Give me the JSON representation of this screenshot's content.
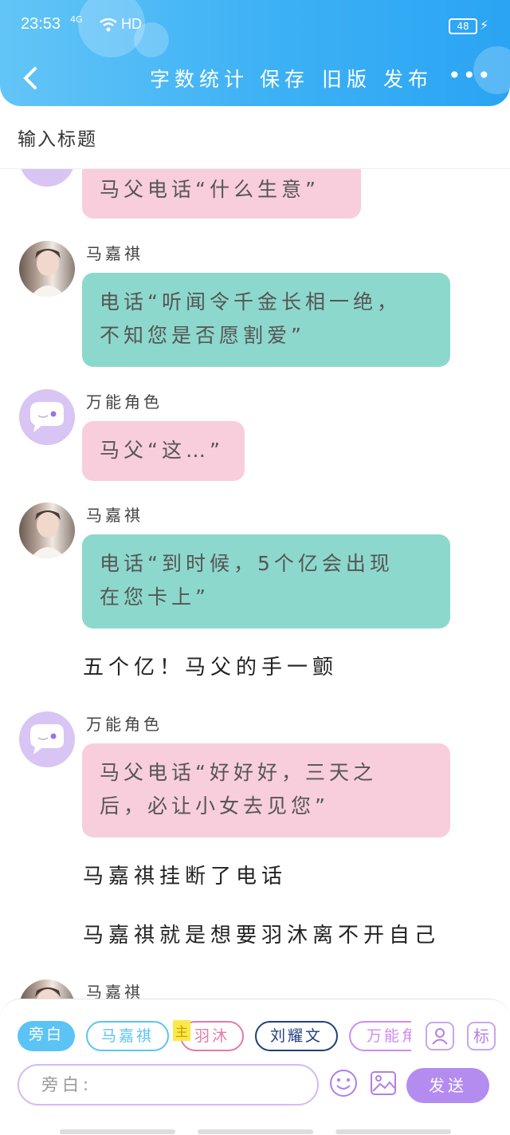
{
  "status_bar": {
    "time": "23:53",
    "network": "4G",
    "wifi_label": "HD",
    "battery": "48"
  },
  "header": {
    "word_count": "字数统计",
    "save": "保存",
    "old_version": "旧版",
    "publish": "发布",
    "more": "•••"
  },
  "title_placeholder": "输入标题",
  "chat": [
    {
      "name": "",
      "text": "马父电话“什么生意”"
    },
    {
      "name": "马嘉祺",
      "text_line1": "电话“听闻令千金长相一绝，",
      "text_line2": "不知您是否愿割爱”"
    },
    {
      "name": "万能角色",
      "text": "马父“这…”"
    },
    {
      "name": "马嘉祺",
      "text_line1": "电话“到时候，5个亿会出现",
      "text_line2": "在您卡上”"
    },
    {
      "narration": "五个亿！马父的手一颤"
    },
    {
      "name": "万能角色",
      "text_line1": "马父电话“好好好，三天之",
      "text_line2": "后，必让小女去见您”"
    },
    {
      "narration": "马嘉祺挂断了电话"
    },
    {
      "narration": "马嘉祺就是想要羽沐离不开自己"
    },
    {
      "name": "马嘉祺"
    }
  ],
  "roles": {
    "narration": "旁白",
    "r1": "马嘉祺",
    "main_tag": "主",
    "r2": "羽沐",
    "r3": "刘耀文",
    "r4": "万能角色",
    "role_btn_label": "标"
  },
  "composer": {
    "placeholder": "旁白:",
    "send": "发送"
  },
  "colors": {
    "header": "#3fb2f5",
    "pink_bubble": "#f8cedc",
    "teal_bubble": "#8dd8cd",
    "send": "#b48cf0"
  }
}
